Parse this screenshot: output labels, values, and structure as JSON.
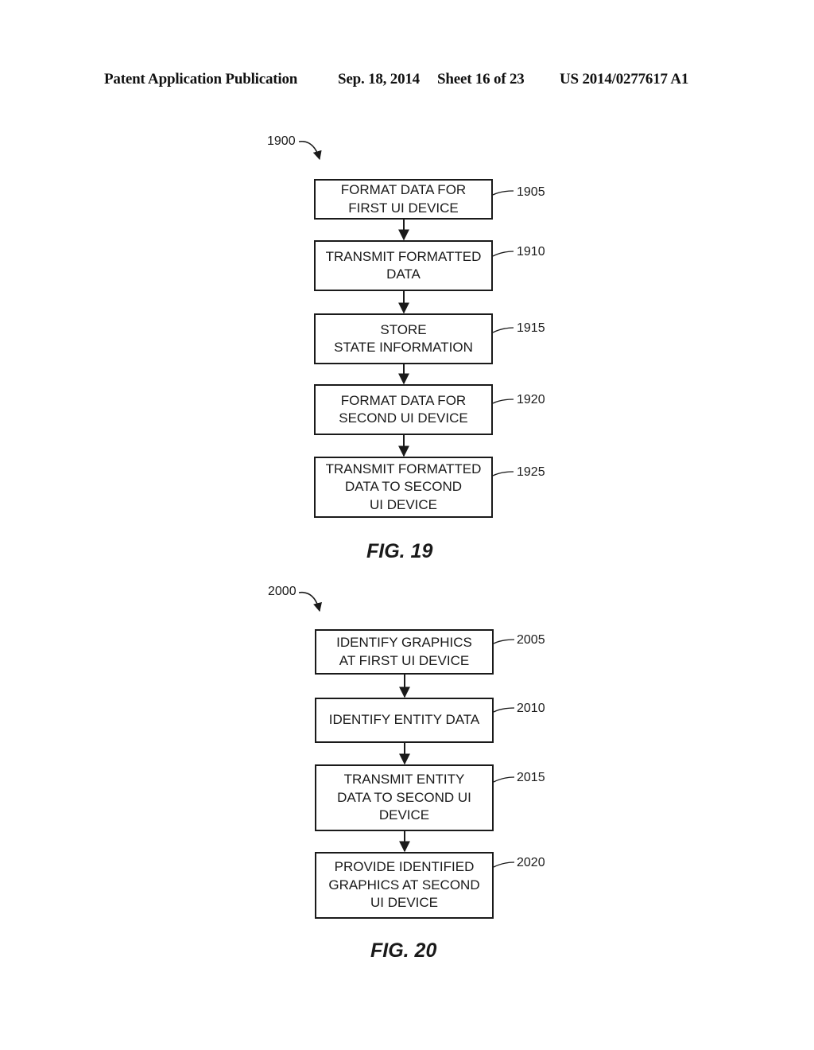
{
  "header": {
    "publication": "Patent Application Publication",
    "date": "Sep. 18, 2014",
    "sheet": "Sheet 16 of 23",
    "number": "US 2014/0277617 A1"
  },
  "fig19": {
    "ref": "1900",
    "caption": "FIG. 19",
    "steps": [
      {
        "ref": "1905",
        "text": "FORMAT DATA FOR\nFIRST UI DEVICE"
      },
      {
        "ref": "1910",
        "text": "TRANSMIT FORMATTED\nDATA"
      },
      {
        "ref": "1915",
        "text": "STORE\nSTATE INFORMATION"
      },
      {
        "ref": "1920",
        "text": "FORMAT DATA FOR\nSECOND UI DEVICE"
      },
      {
        "ref": "1925",
        "text": "TRANSMIT FORMATTED\nDATA TO SECOND\nUI DEVICE"
      }
    ]
  },
  "fig20": {
    "ref": "2000",
    "caption": "FIG. 20",
    "steps": [
      {
        "ref": "2005",
        "text": "IDENTIFY GRAPHICS\nAT FIRST UI DEVICE"
      },
      {
        "ref": "2010",
        "text": "IDENTIFY ENTITY DATA"
      },
      {
        "ref": "2015",
        "text": "TRANSMIT ENTITY\nDATA TO SECOND UI\nDEVICE"
      },
      {
        "ref": "2020",
        "text": "PROVIDE IDENTIFIED\nGRAPHICS AT SECOND\nUI DEVICE"
      }
    ]
  }
}
